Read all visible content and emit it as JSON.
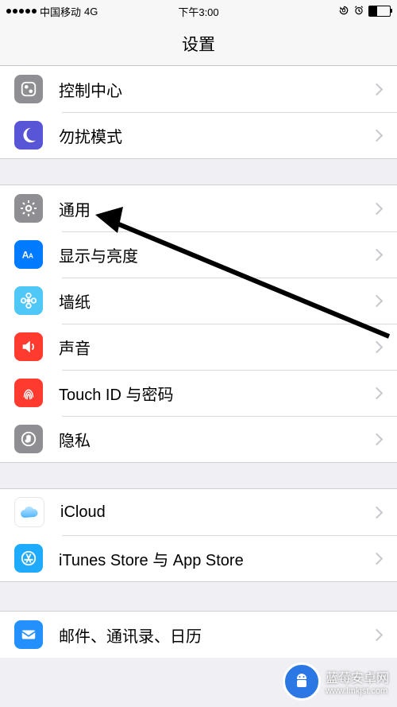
{
  "status": {
    "carrier": "中国移动",
    "network": "4G",
    "time": "下午3:00"
  },
  "nav": {
    "title": "设置"
  },
  "groups": {
    "g1": [
      {
        "key": "control-center",
        "label": "控制中心"
      },
      {
        "key": "dnd",
        "label": "勿扰模式"
      }
    ],
    "g2": [
      {
        "key": "general",
        "label": "通用"
      },
      {
        "key": "display",
        "label": "显示与亮度"
      },
      {
        "key": "wallpaper",
        "label": "墙纸"
      },
      {
        "key": "sound",
        "label": "声音"
      },
      {
        "key": "touchid",
        "label": "Touch ID 与密码"
      },
      {
        "key": "privacy",
        "label": "隐私"
      }
    ],
    "g3": [
      {
        "key": "icloud",
        "label": "iCloud"
      },
      {
        "key": "appstore",
        "label": "iTunes Store 与 App Store"
      }
    ],
    "g4": [
      {
        "key": "mail",
        "label": "邮件、通讯录、日历"
      }
    ]
  },
  "watermark": {
    "title": "蓝莓安卓网",
    "url": "www.lmkjst.com"
  }
}
